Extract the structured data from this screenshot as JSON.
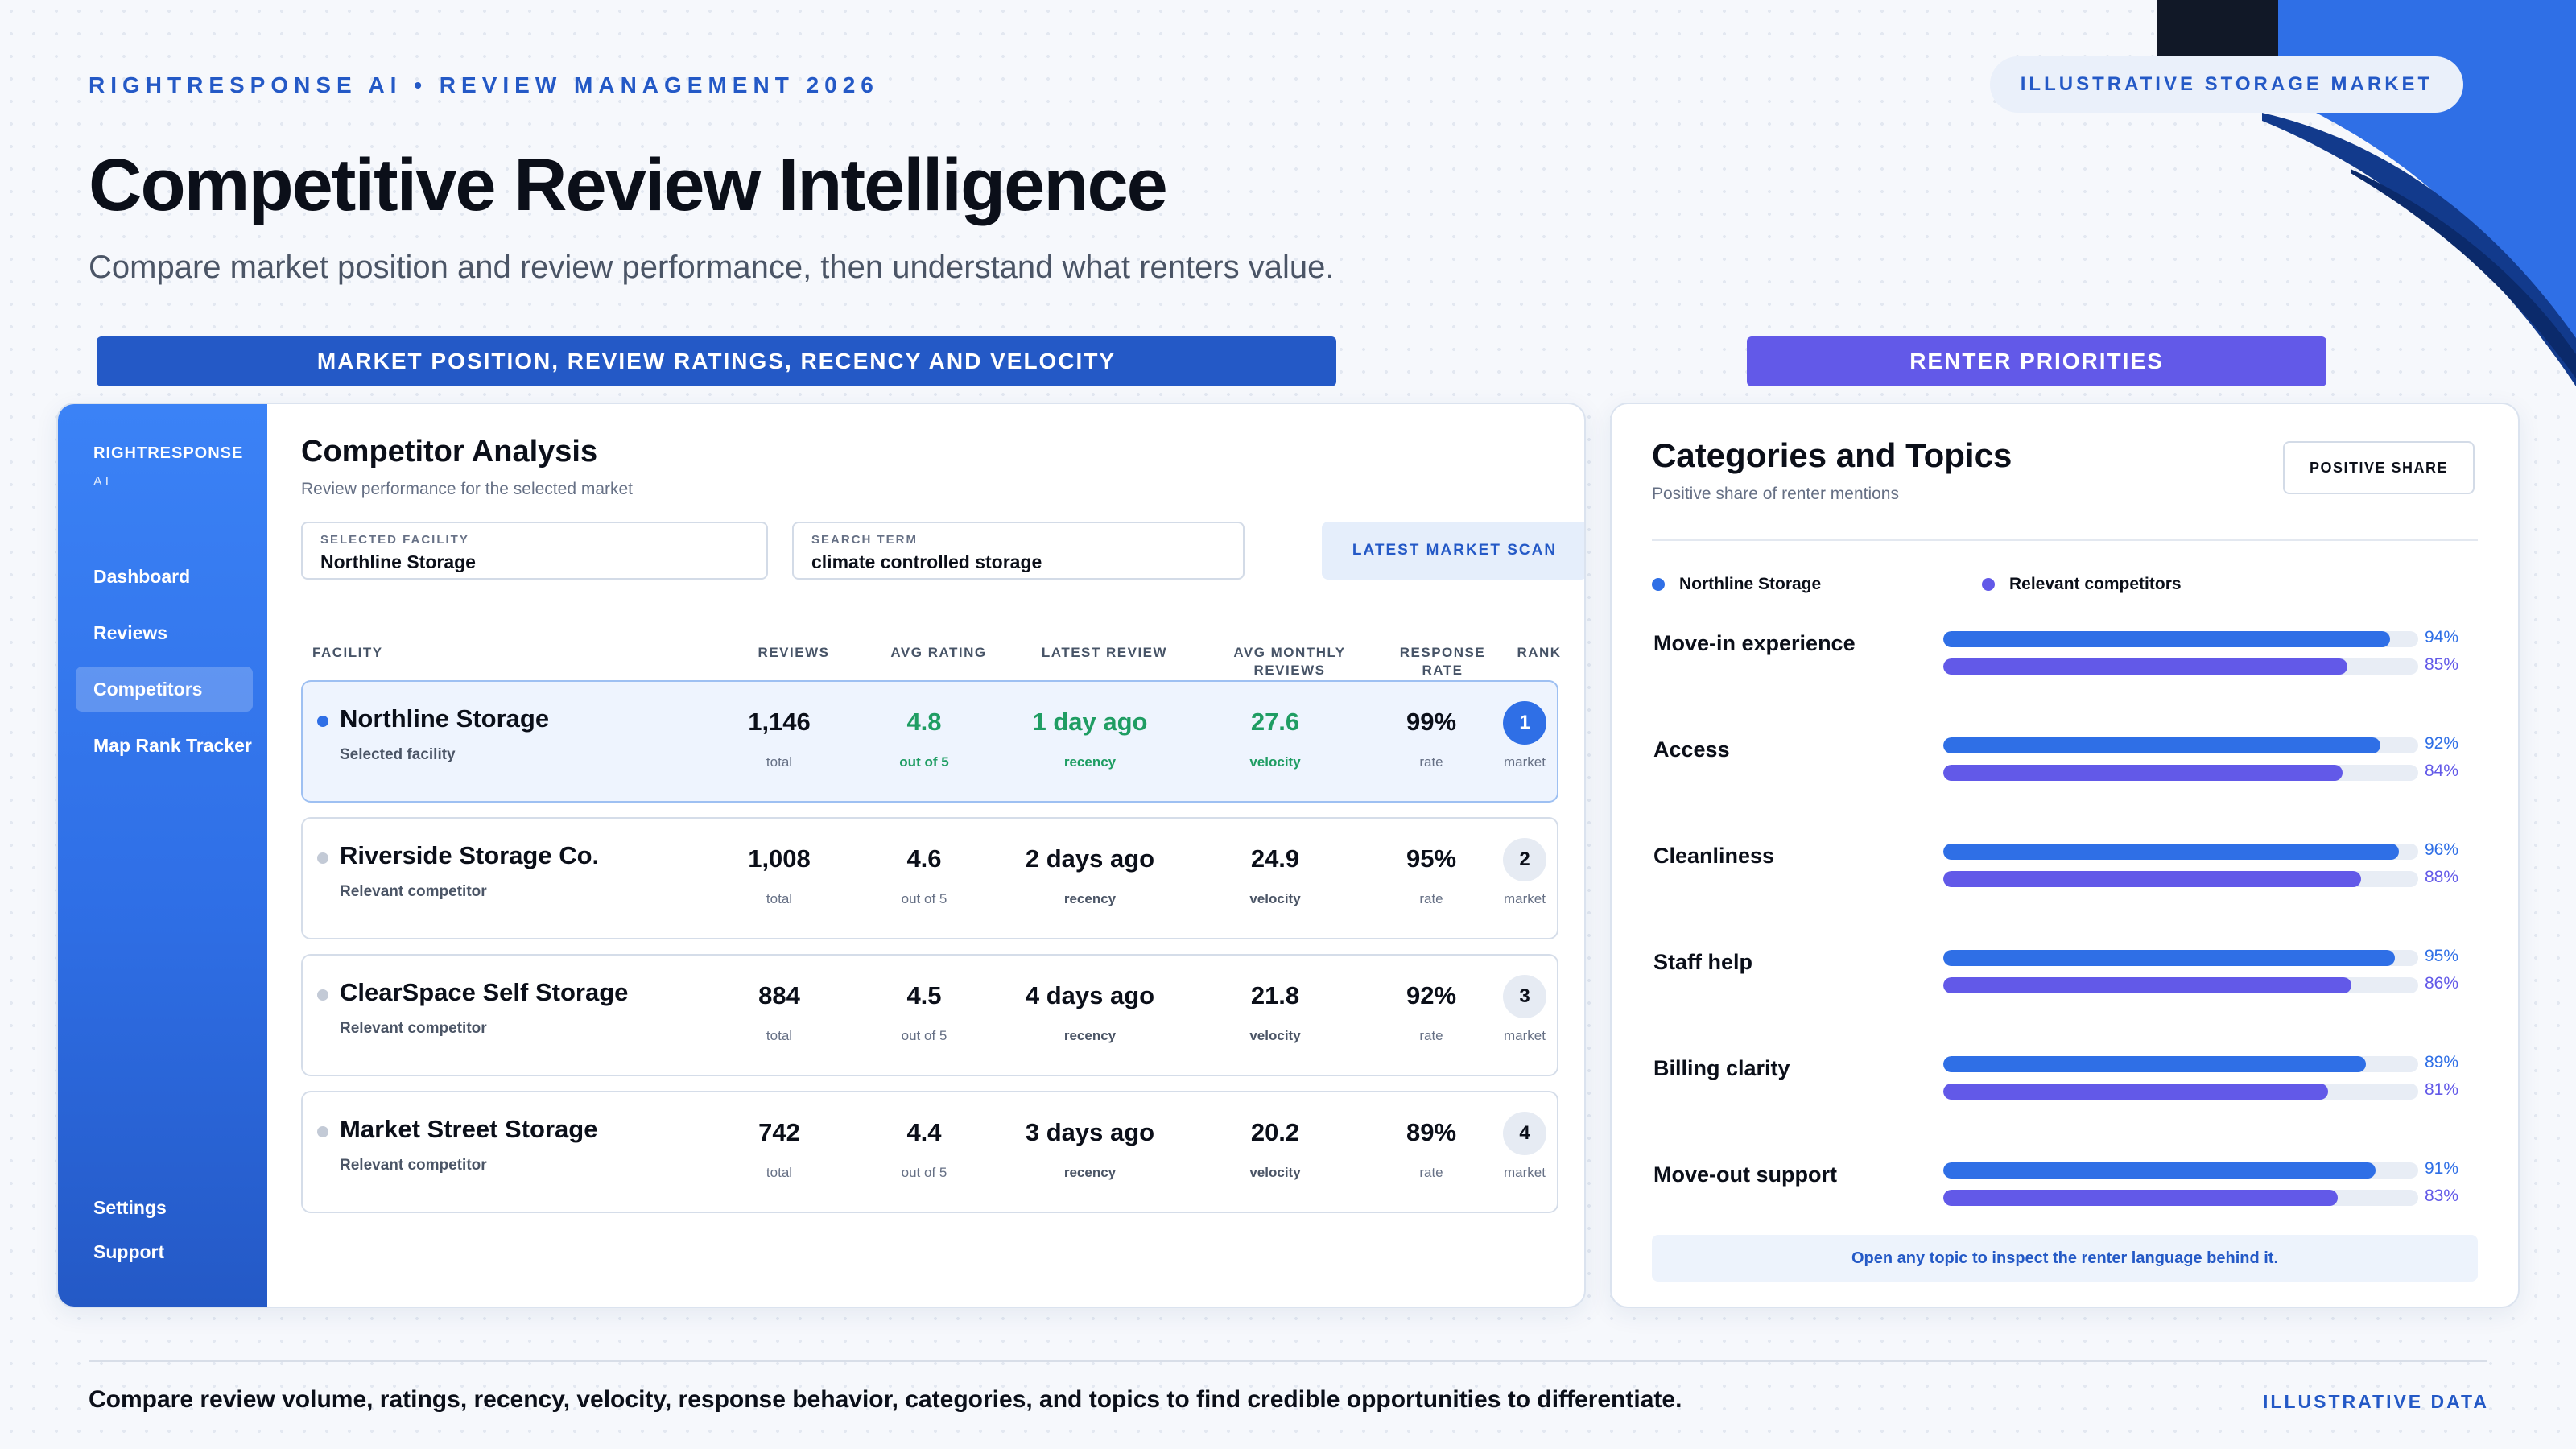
{
  "header": {
    "eyebrow": "RIGHTRESPONSE AI • REVIEW MANAGEMENT 2026",
    "market_badge": "ILLUSTRATIVE STORAGE MARKET",
    "title": "Competitive Review Intelligence",
    "subtitle": "Compare market position and review performance, then understand what renters value."
  },
  "banners": {
    "left": "MARKET POSITION, REVIEW RATINGS, RECENCY AND VELOCITY",
    "right": "RENTER PRIORITIES"
  },
  "sidebar": {
    "brand": "RIGHTRESPONSE",
    "brand_sub": "AI",
    "items": [
      {
        "label": "Dashboard",
        "active": false
      },
      {
        "label": "Reviews",
        "active": false
      },
      {
        "label": "Competitors",
        "active": true
      },
      {
        "label": "Map Rank Tracker",
        "active": false
      }
    ],
    "bottom_items": [
      {
        "label": "Settings"
      },
      {
        "label": "Support"
      }
    ]
  },
  "competitor_panel": {
    "title": "Competitor Analysis",
    "subtitle": "Review performance for the selected market",
    "facility_field": {
      "label": "SELECTED FACILITY",
      "value": "Northline Storage"
    },
    "search_field": {
      "label": "SEARCH TERM",
      "value": "climate controlled storage"
    },
    "scan_button": "LATEST MARKET SCAN",
    "columns": {
      "facility": "FACILITY",
      "reviews": "REVIEWS",
      "avg_rating": "AVG RATING",
      "latest_review": "LATEST REVIEW",
      "monthly_1": "AVG MONTHLY",
      "monthly_2": "REVIEWS",
      "response_1": "RESPONSE",
      "response_2": "RATE",
      "rank": "RANK"
    },
    "rows": [
      {
        "name": "Northline Storage",
        "sub": "Selected facility",
        "selected": true,
        "reviews": "1,146",
        "reviews_label": "total",
        "rating": "4.8",
        "rating_label": "out of 5",
        "latest": "1 day ago",
        "latest_label": "recency",
        "velocity": "27.6",
        "velocity_label": "velocity",
        "response": "99%",
        "response_label": "rate",
        "rank": "1",
        "rank_label": "market"
      },
      {
        "name": "Riverside Storage Co.",
        "sub": "Relevant competitor",
        "selected": false,
        "reviews": "1,008",
        "reviews_label": "total",
        "rating": "4.6",
        "rating_label": "out of 5",
        "latest": "2 days ago",
        "latest_label": "recency",
        "velocity": "24.9",
        "velocity_label": "velocity",
        "response": "95%",
        "response_label": "rate",
        "rank": "2",
        "rank_label": "market"
      },
      {
        "name": "ClearSpace Self Storage",
        "sub": "Relevant competitor",
        "selected": false,
        "reviews": "884",
        "reviews_label": "total",
        "rating": "4.5",
        "rating_label": "out of 5",
        "latest": "4 days ago",
        "latest_label": "recency",
        "velocity": "21.8",
        "velocity_label": "velocity",
        "response": "92%",
        "response_label": "rate",
        "rank": "3",
        "rank_label": "market"
      },
      {
        "name": "Market Street Storage",
        "sub": "Relevant competitor",
        "selected": false,
        "reviews": "742",
        "reviews_label": "total",
        "rating": "4.4",
        "rating_label": "out of 5",
        "latest": "3 days ago",
        "latest_label": "recency",
        "velocity": "20.2",
        "velocity_label": "velocity",
        "response": "89%",
        "response_label": "rate",
        "rank": "4",
        "rank_label": "market"
      }
    ]
  },
  "categories_panel": {
    "title": "Categories and Topics",
    "subtitle": "Positive share of renter mentions",
    "share_button": "POSITIVE SHARE",
    "legend": {
      "primary": "Northline Storage",
      "secondary": "Relevant competitors"
    },
    "colors": {
      "primary": "#2f6fe6",
      "secondary": "#6259e8",
      "track": "#e8edf5"
    },
    "topics": [
      {
        "label": "Move-in experience",
        "primary": 94,
        "secondary": 85,
        "primary_text": "94%",
        "secondary_text": "85%"
      },
      {
        "label": "Access",
        "primary": 92,
        "secondary": 84,
        "primary_text": "92%",
        "secondary_text": "84%"
      },
      {
        "label": "Cleanliness",
        "primary": 96,
        "secondary": 88,
        "primary_text": "96%",
        "secondary_text": "88%"
      },
      {
        "label": "Staff help",
        "primary": 95,
        "secondary": 86,
        "primary_text": "95%",
        "secondary_text": "86%"
      },
      {
        "label": "Billing clarity",
        "primary": 89,
        "secondary": 81,
        "primary_text": "89%",
        "secondary_text": "81%"
      },
      {
        "label": "Move-out support",
        "primary": 91,
        "secondary": 83,
        "primary_text": "91%",
        "secondary_text": "83%"
      }
    ],
    "footer_note": "Open any topic to inspect the renter language behind it."
  },
  "footer": {
    "text": "Compare review volume, ratings, recency, velocity, response behavior, categories, and topics to find credible opportunities to differentiate.",
    "badge": "ILLUSTRATIVE DATA"
  }
}
